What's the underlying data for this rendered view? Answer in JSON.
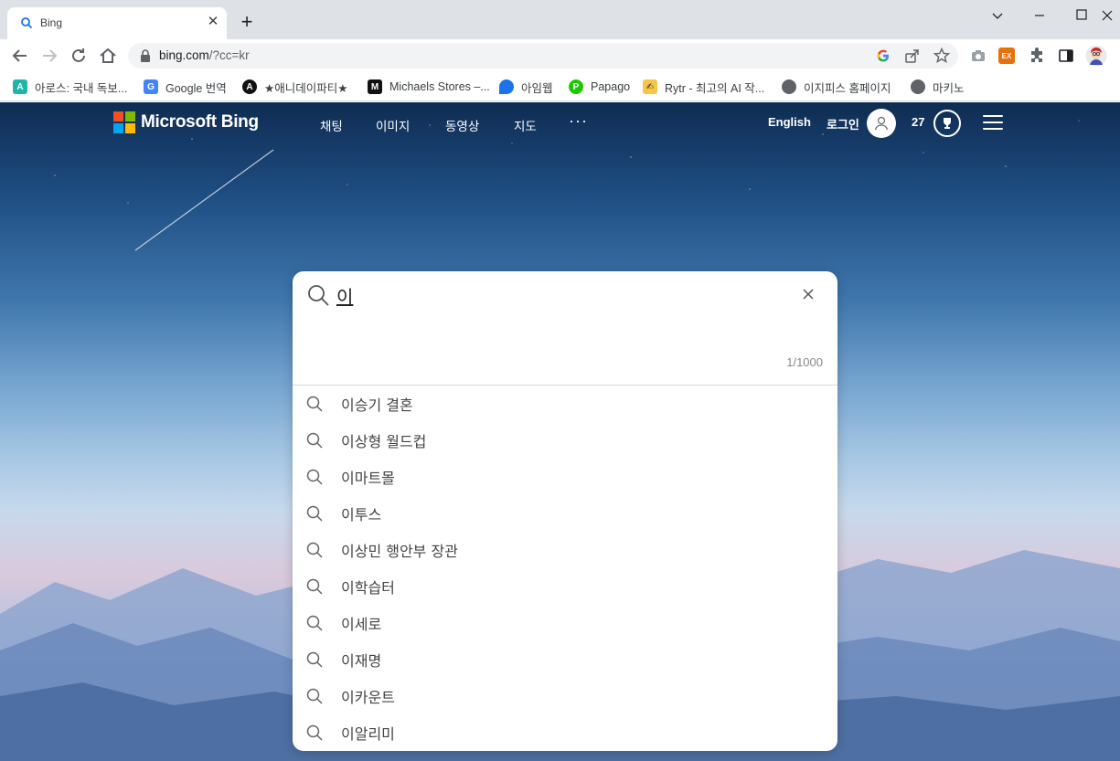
{
  "browser": {
    "tab_title": "Bing",
    "url_host": "bing.com",
    "url_path": "/?cc=kr",
    "bookmarks": [
      {
        "label": "아로스: 국내 독보...",
        "icon": "letter-a-icon",
        "color": "#1fb5a9",
        "glyph": "A"
      },
      {
        "label": "Google 번역",
        "icon": "google-translate-icon",
        "color": "#4285f4",
        "glyph": "G"
      },
      {
        "label": "★애니데이파티★",
        "icon": "anyday-icon",
        "color": "#111111",
        "glyph": "A"
      },
      {
        "label": "Michaels Stores –...",
        "icon": "michaels-icon",
        "color": "#111111",
        "glyph": "M"
      },
      {
        "label": "아임웹",
        "icon": "imweb-icon",
        "color": "#1a73e8",
        "glyph": ""
      },
      {
        "label": "Papago",
        "icon": "papago-icon",
        "color": "#1ec800",
        "glyph": "P"
      },
      {
        "label": "Rytr - 최고의 AI 작...",
        "icon": "rytr-icon",
        "color": "#f6c744",
        "glyph": "✍"
      },
      {
        "label": "이지피스 홈페이지",
        "icon": "globe-icon",
        "color": "#5f6368",
        "glyph": ""
      },
      {
        "label": "마키노",
        "icon": "globe-icon",
        "color": "#5f6368",
        "glyph": ""
      }
    ]
  },
  "header": {
    "logo_text": "Microsoft Bing",
    "nav": [
      "채팅",
      "이미지",
      "동영상",
      "지도"
    ],
    "more": "···",
    "language": "English",
    "login": "로그인",
    "points": "27"
  },
  "search": {
    "query": "이",
    "counter": "1/1000",
    "suggestions": [
      "이승기 결혼",
      "이상형 월드컵",
      "이마트몰",
      "이투스",
      "이상민 행안부 장관",
      "이학습터",
      "이세로",
      "이재명",
      "이카운트",
      "이알리미"
    ]
  },
  "colors": {
    "logo_red": "#f25022",
    "logo_green": "#7fba00",
    "logo_blue": "#00a4ef",
    "logo_yellow": "#ffb900"
  }
}
